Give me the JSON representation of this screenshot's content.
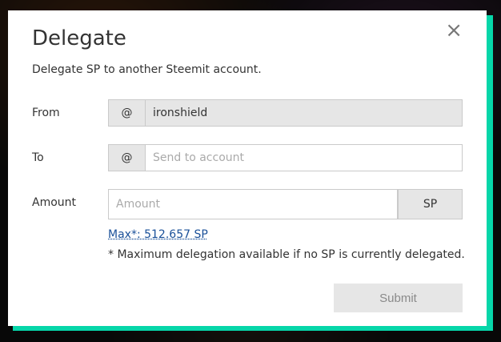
{
  "modal": {
    "title": "Delegate",
    "subtitle": "Delegate SP to another Steemit account.",
    "close_glyph": "×"
  },
  "from": {
    "label": "From",
    "prefix": "@",
    "value": "ironshield"
  },
  "to": {
    "label": "To",
    "prefix": "@",
    "placeholder": "Send to account",
    "value": ""
  },
  "amount": {
    "label": "Amount",
    "placeholder": "Amount",
    "value": "",
    "unit": "SP",
    "max_link": "Max*: 512.657 SP",
    "note": "* Maximum delegation available if no SP is currently delegated."
  },
  "submit": {
    "label": "Submit"
  },
  "colors": {
    "accent_shadow": "#06d6a9",
    "link": "#1a5099"
  }
}
